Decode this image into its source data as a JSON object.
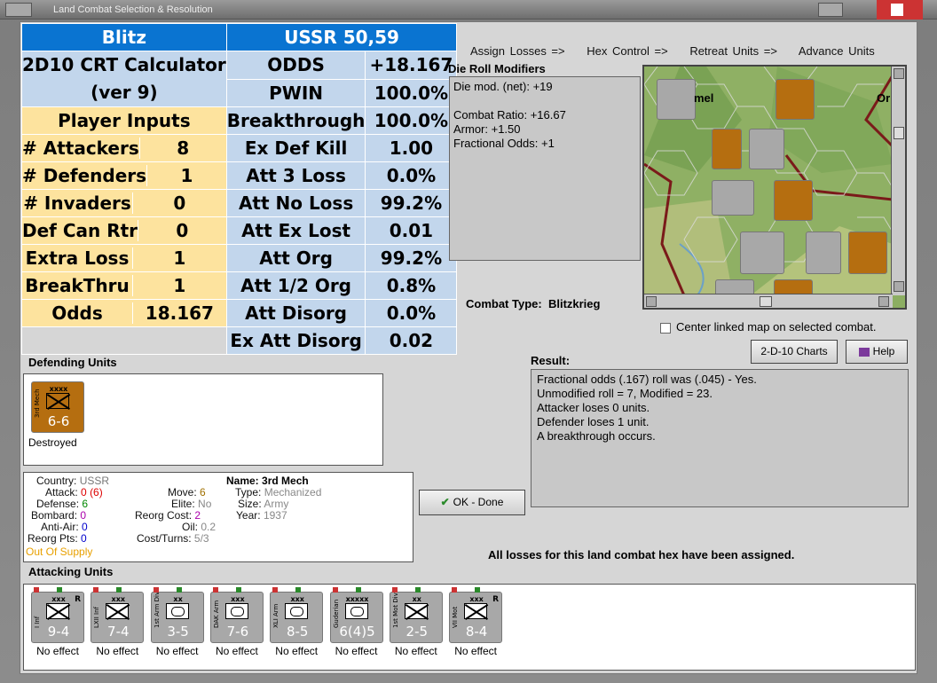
{
  "window": {
    "title": "Land Combat Selection & Resolution"
  },
  "crt": {
    "header_left": "Blitz",
    "header_right": "USSR 50,59",
    "calc_title": "2D10 CRT Calculator",
    "calc_version": "(ver 9)",
    "player_inputs": "Player Inputs",
    "inputs": [
      {
        "label": "# Attackers",
        "value": "8"
      },
      {
        "label": "# Defenders",
        "value": "1"
      },
      {
        "label": "# Invaders",
        "value": "0"
      },
      {
        "label": "Def Can Rtr",
        "value": "0"
      },
      {
        "label": "Extra Loss",
        "value": "1"
      },
      {
        "label": "BreakThru",
        "value": "1"
      },
      {
        "label": "Odds",
        "value": "18.167"
      }
    ],
    "results": [
      {
        "label": "ODDS",
        "value": "+18.167"
      },
      {
        "label": "PWIN",
        "value": "100.0%"
      },
      {
        "label": "Breakthrough",
        "value": "100.0%"
      },
      {
        "label": "Ex Def Kill",
        "value": "1.00"
      },
      {
        "label": "Att 3 Loss",
        "value": "0.0%"
      },
      {
        "label": "Att No Loss",
        "value": "99.2%"
      },
      {
        "label": "Att Ex Lost",
        "value": "0.01"
      },
      {
        "label": "Att Org",
        "value": "99.2%"
      },
      {
        "label": "Att 1/2 Org",
        "value": "0.8%"
      },
      {
        "label": "Att Disorg",
        "value": "0.0%"
      },
      {
        "label": "Ex Att Disorg",
        "value": "0.02"
      }
    ]
  },
  "phases": [
    "Assign Losses =>",
    "Hex Control =>",
    "Retreat Units =>",
    "Advance Units"
  ],
  "die_roll": {
    "title": "Die Roll Modifiers",
    "lines": [
      "Die mod. (net): +19",
      "",
      "Combat Ratio: +16.67",
      "Armor: +1.50",
      "Fractional Odds: +1"
    ]
  },
  "combat_type": {
    "label": "Combat Type:",
    "value": "Blitzkrieg"
  },
  "center_map": {
    "label": "Center linked map on selected combat.",
    "checked": false
  },
  "buttons": {
    "charts": "2-D-10 Charts",
    "help": "Help",
    "ok": "OK - Done"
  },
  "result": {
    "title": "Result:",
    "lines": [
      "Fractional odds (.167) roll was (.045)  - Yes.",
      "Unmodified roll = 7, Modified = 23.",
      "Attacker loses 0 units.",
      "Defender loses 1 unit.",
      "A breakthrough occurs."
    ]
  },
  "defending": {
    "title": "Defending Units",
    "unit": {
      "size": "xxxx",
      "name": "3rd Mech",
      "strength": "6-6",
      "status": "Destroyed"
    }
  },
  "info": {
    "country_label": "Country:",
    "country": "USSR",
    "attack_label": "Attack:",
    "attack": "0",
    "attack_orig": "(6)",
    "defense_label": "Defense:",
    "defense": "6",
    "bombard_label": "Bombard:",
    "bombard": "0",
    "antiair_label": "Anti-Air:",
    "antiair": "0",
    "reorg_label": "Reorg Pts:",
    "reorg": "0",
    "supply": "Out Of Supply",
    "move_label": "Move:",
    "move": "6",
    "elite_label": "Elite:",
    "elite": "No",
    "reorgcost_label": "Reorg Cost:",
    "reorgcost": "2",
    "oil_label": "Oil:",
    "oil": "0.2",
    "cost_label": "Cost/Turns:",
    "cost": "5/3",
    "name_label": "Name:",
    "name": "3rd Mech",
    "type_label": "Type:",
    "type": "Mechanized",
    "size_label": "Size:",
    "size": "Army",
    "year_label": "Year:",
    "year": "1937"
  },
  "all_losses": "All losses for this land combat hex have been assigned.",
  "attacking": {
    "title": "Attacking Units",
    "units": [
      {
        "size": "xxx",
        "name": "I Inf",
        "strength": "9-4",
        "status": "No effect",
        "r": "R",
        "sym": "x"
      },
      {
        "size": "xxx",
        "name": "LXII Inf",
        "strength": "7-4",
        "status": "No effect",
        "r": "",
        "sym": "x"
      },
      {
        "size": "xx",
        "name": "1st Arm Div",
        "strength": "3-5",
        "status": "No effect",
        "r": "",
        "sym": "o"
      },
      {
        "size": "xxx",
        "name": "DAK Arm",
        "strength": "7-6",
        "status": "No effect",
        "r": "",
        "sym": "o"
      },
      {
        "size": "xxx",
        "name": "XLI Arm",
        "strength": "8-5",
        "status": "No effect",
        "r": "",
        "sym": "o"
      },
      {
        "size": "xxxxx",
        "name": "Guderian",
        "strength": "6(4)5",
        "status": "No effect",
        "r": "",
        "sym": "o"
      },
      {
        "size": "xx",
        "name": "1st Mot Div",
        "strength": "2-5",
        "status": "No effect",
        "r": "",
        "sym": "x"
      },
      {
        "size": "xxx",
        "name": "VII Mot",
        "strength": "8-4",
        "status": "No effect",
        "r": "R",
        "sym": "x"
      }
    ]
  },
  "map": {
    "labels": [
      "mel",
      "Or"
    ]
  }
}
